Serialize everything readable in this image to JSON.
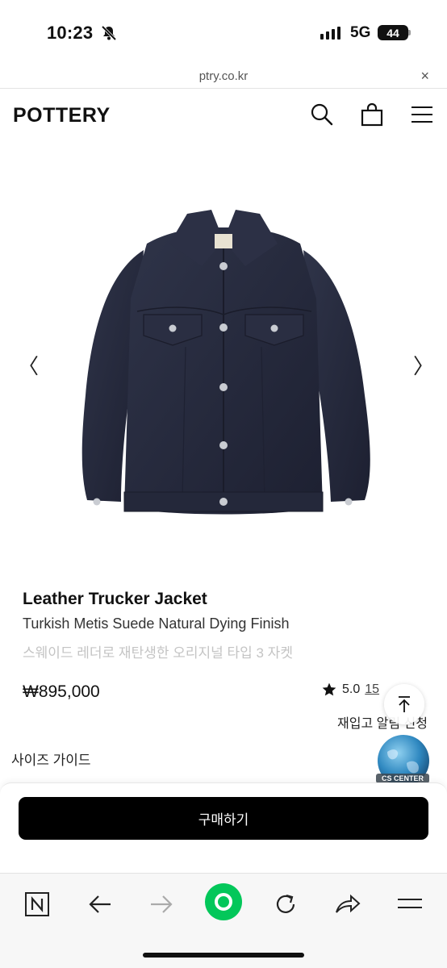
{
  "status_bar": {
    "time": "10:23",
    "network": "5G",
    "battery": "44"
  },
  "browser": {
    "url": "ptry.co.kr",
    "close_label": "×"
  },
  "header": {
    "logo": "POTTERY",
    "icons": [
      "search-icon",
      "shopping-bag-icon",
      "menu-icon"
    ]
  },
  "gallery": {
    "prev_label": "〈",
    "next_label": "〉",
    "image": "navy suede trucker jacket"
  },
  "product": {
    "title": "Leather Trucker Jacket",
    "subtitle": "Turkish Metis Suede Natural Dying Finish",
    "description": "스웨이드 레더로 재탄생한 오리지널 타입 3 자켓",
    "price": "₩895,000",
    "rating": "5.0",
    "review_count": "15",
    "restock_label": "재입고 알림 신청",
    "size_guide_label": "사이즈 가이드"
  },
  "floating": {
    "cs_label": "CS CENTER"
  },
  "purchase": {
    "buy_label": "구매하기"
  },
  "colors": {
    "accent_green": "#03c75a",
    "jacket_navy": "#2b2f45"
  }
}
